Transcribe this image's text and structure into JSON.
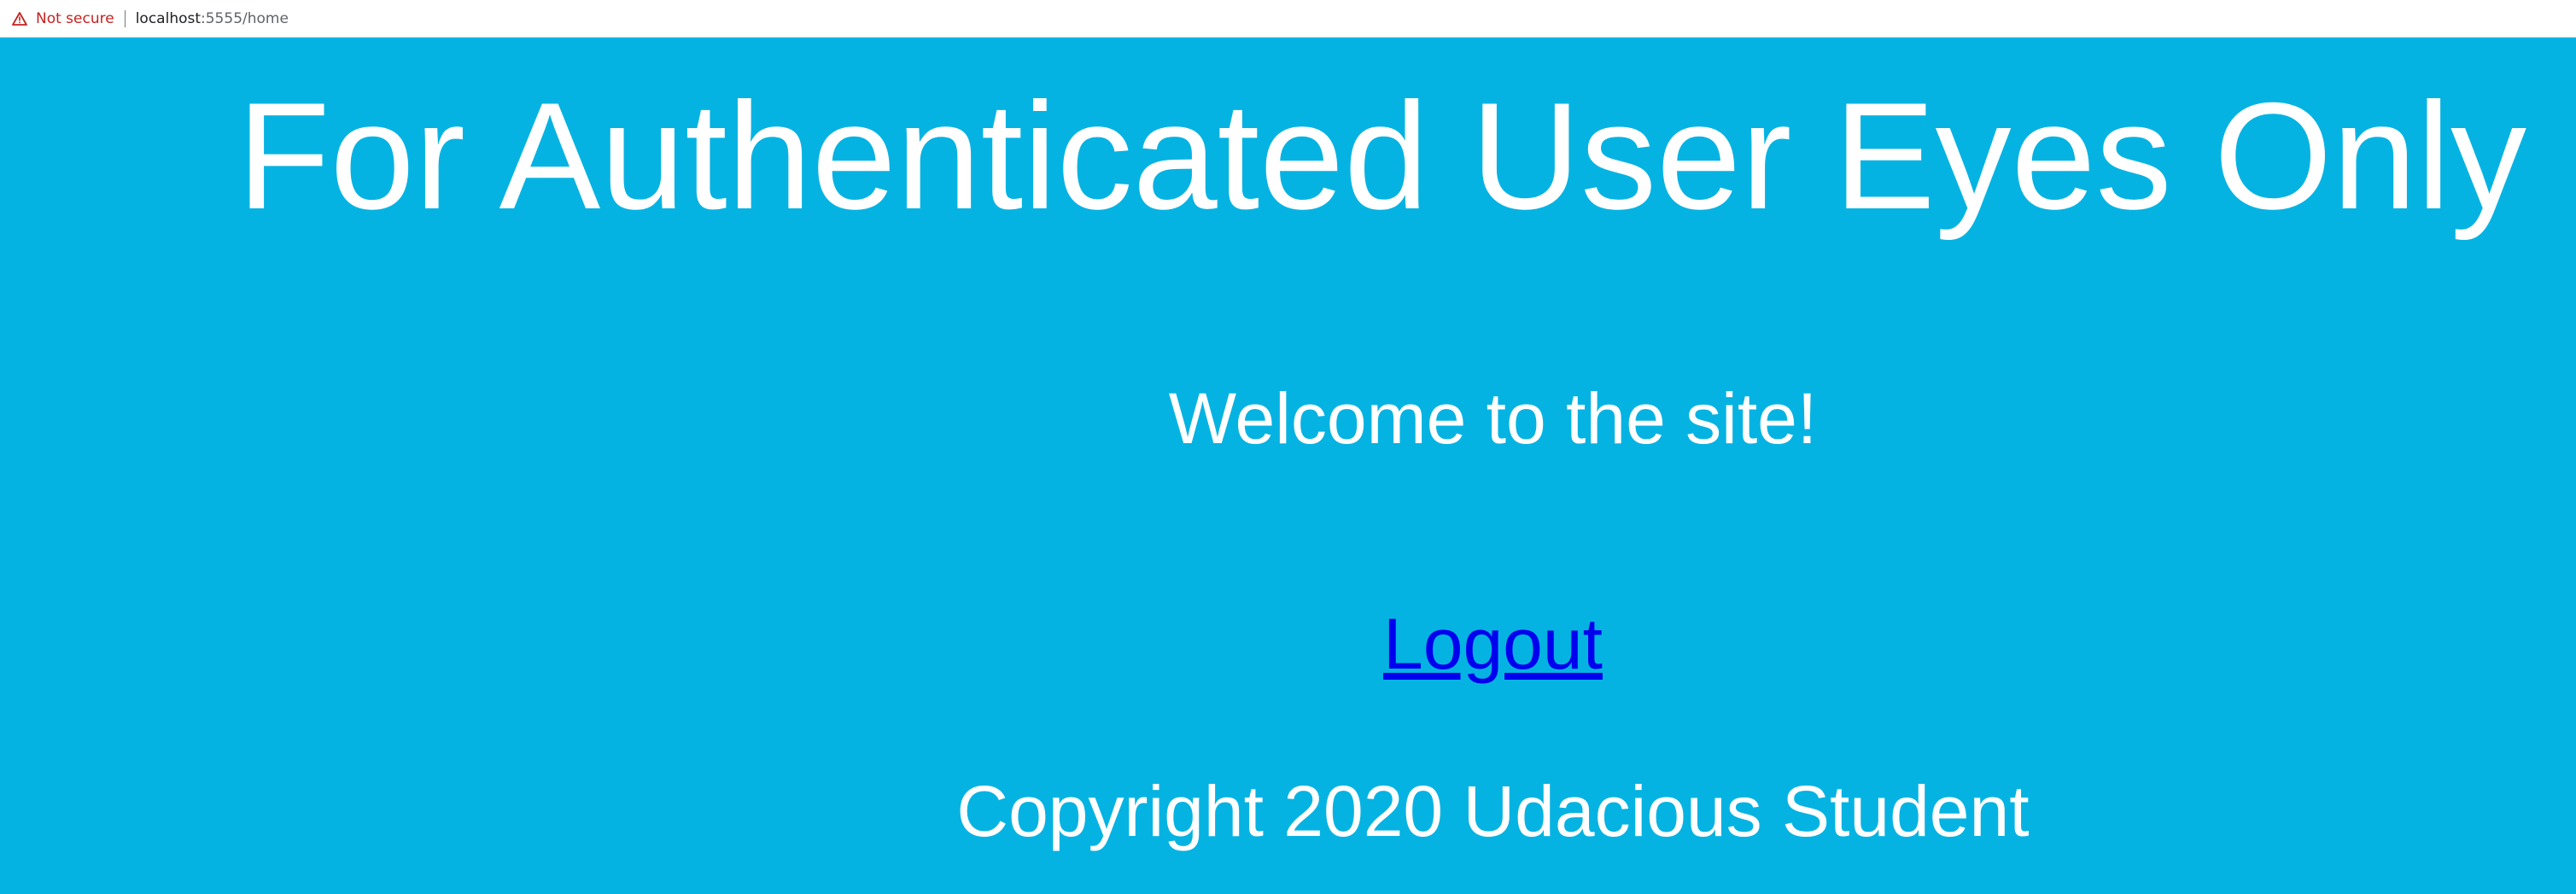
{
  "browser": {
    "security_label": "Not secure",
    "url_host": "localhost",
    "url_rest": ":5555/home",
    "warning_color": "#c5221f"
  },
  "page": {
    "background_color": "#05b3e2",
    "heading": "For Authenticated User Eyes Only",
    "welcome": "Welcome to the site!",
    "logout_label": "Logout",
    "copyright": "Copyright 2020 Udacious Student"
  }
}
